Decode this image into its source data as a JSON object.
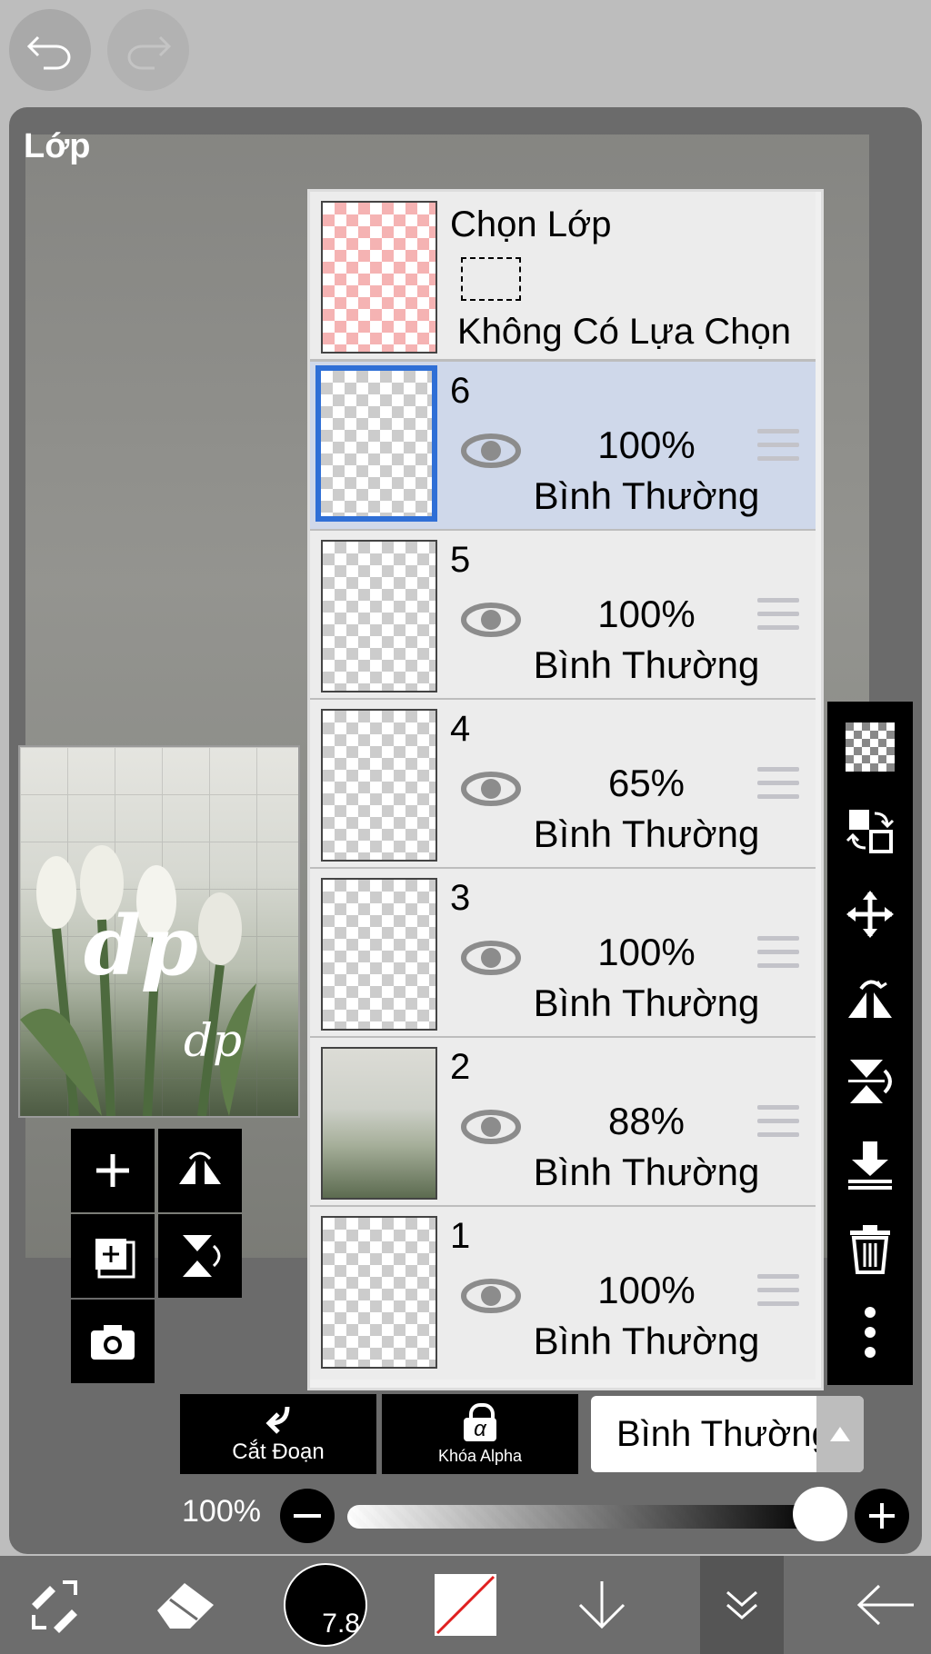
{
  "top": {
    "undo_icon": "undo-icon",
    "redo_icon": "redo-icon"
  },
  "panel": {
    "title": "Lớp"
  },
  "selection_layer": {
    "title": "Chọn Lớp",
    "status": "Không Có Lựa Chọn"
  },
  "layers": [
    {
      "number": "6",
      "opacity": "100%",
      "blend": "Bình Thường",
      "selected": true
    },
    {
      "number": "5",
      "opacity": "100%",
      "blend": "Bình Thường",
      "selected": false
    },
    {
      "number": "4",
      "opacity": "65%",
      "blend": "Bình Thường",
      "selected": false
    },
    {
      "number": "3",
      "opacity": "100%",
      "blend": "Bình Thường",
      "selected": false
    },
    {
      "number": "2",
      "opacity": "88%",
      "blend": "Bình Thường",
      "selected": false
    },
    {
      "number": "1",
      "opacity": "100%",
      "blend": "Bình Thường",
      "selected": false
    }
  ],
  "right_toolbar": [
    "checker-icon",
    "swap-layer-icon",
    "move-icon",
    "flip-horizontal-icon",
    "flip-vertical-icon",
    "merge-down-icon",
    "trash-icon",
    "more-icon"
  ],
  "left_tools": [
    "add-layer-icon",
    "flip-horizontal-icon",
    "add-copy-icon",
    "flip-vertical-icon",
    "camera-icon"
  ],
  "bottom_controls": {
    "clip_label": "Cắt Đoạn",
    "alpha_lock_label": "Khóa Alpha",
    "alpha_symbol": "α",
    "blend_mode": "Bình Thường",
    "opacity_label": "100%",
    "opacity_value": 1.0
  },
  "bottom_bar": {
    "brush_size": "7.8"
  },
  "colors": {
    "selected_layer_bg": "#cfd8ea",
    "selected_border": "#2f6fd6",
    "panel_bg": "#6b6b6b"
  }
}
